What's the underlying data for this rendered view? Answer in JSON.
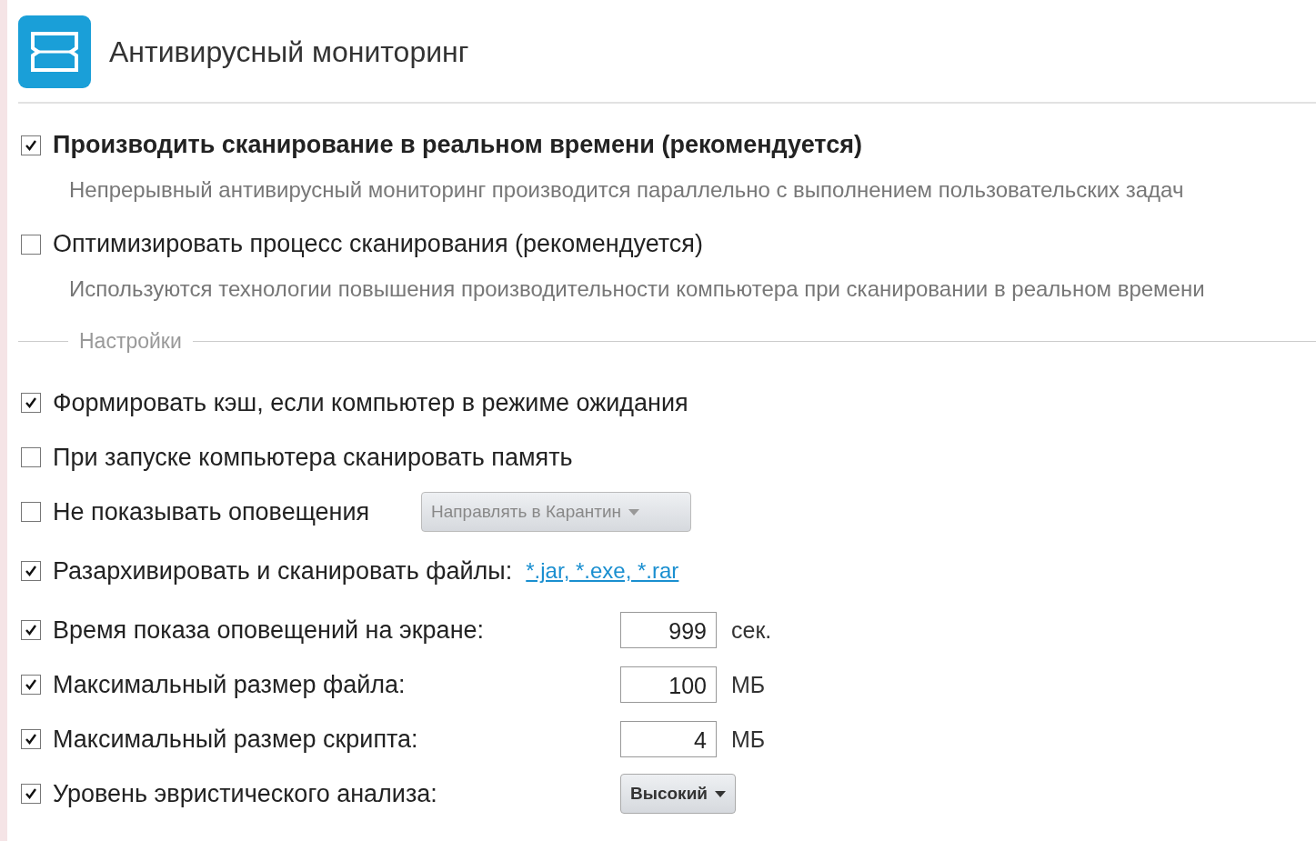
{
  "header": {
    "title": "Антивирусный мониторинг"
  },
  "main_options": [
    {
      "label": "Производить сканирование в реальном времени (рекомендуется)",
      "checked": true,
      "description": "Непрерывный антивирусный мониторинг производится параллельно с выполнением пользовательских задач"
    },
    {
      "label": "Оптимизировать процесс сканирования (рекомендуется)",
      "checked": false,
      "description": "Используются технологии повышения производительности компьютера при сканировании в реальном времени"
    }
  ],
  "settings": {
    "legend": "Настройки",
    "options": [
      {
        "kind": "plain",
        "label": "Формировать кэш, если компьютер в режиме ожидания",
        "checked": true
      },
      {
        "kind": "plain",
        "label": "При запуске компьютера сканировать память",
        "checked": false
      },
      {
        "kind": "action",
        "label": "Не показывать оповещения",
        "checked": false,
        "dropdown": {
          "value": "Направлять в Карантин",
          "disabled": true
        }
      },
      {
        "kind": "link",
        "label": "Разархивировать и сканировать файлы:",
        "checked": true,
        "link": "*.jar, *.exe, *.rar"
      },
      {
        "kind": "number",
        "label": "Время показа оповещений на экране:",
        "checked": true,
        "value": "999",
        "unit": "сек."
      },
      {
        "kind": "number",
        "label": "Максимальный размер файла:",
        "checked": true,
        "value": "100",
        "unit": "МБ"
      },
      {
        "kind": "number",
        "label": "Максимальный размер скрипта:",
        "checked": true,
        "value": "4",
        "unit": "МБ"
      },
      {
        "kind": "select",
        "label": "Уровень эвристического анализа:",
        "checked": true,
        "dropdown": {
          "value": "Высокий",
          "disabled": false
        }
      }
    ]
  }
}
